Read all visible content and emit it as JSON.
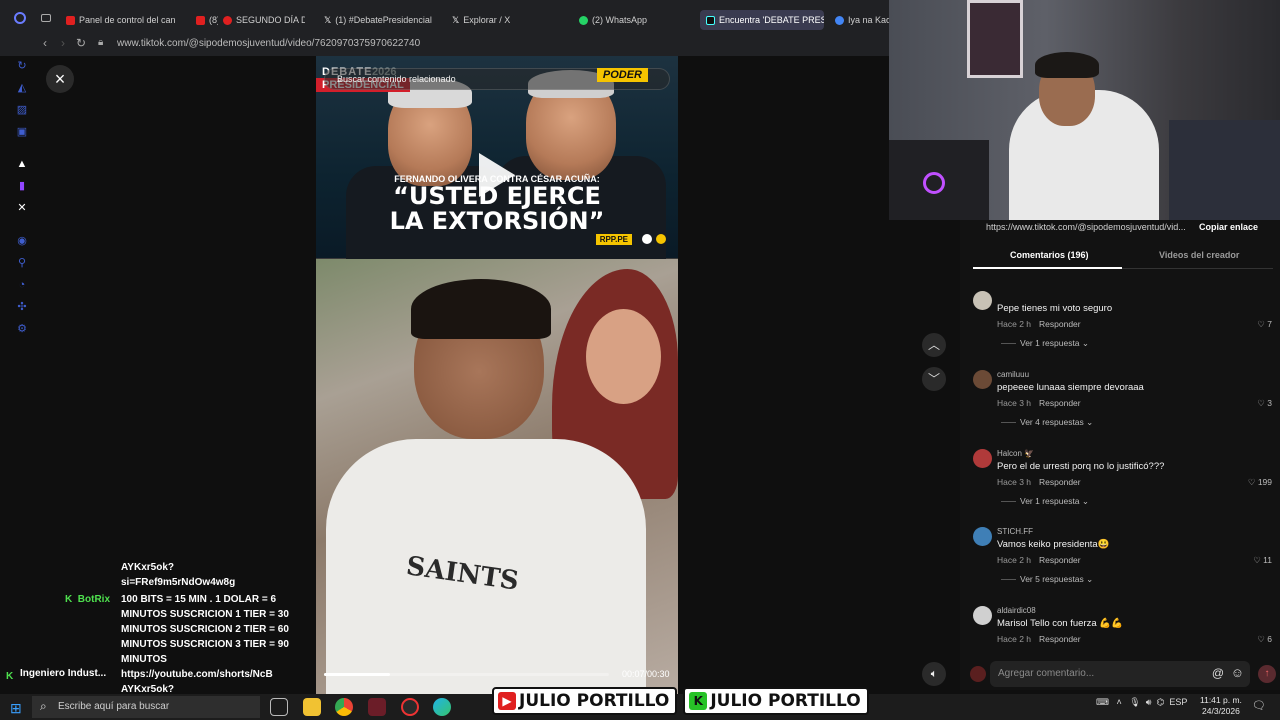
{
  "browser": {
    "tabs": [
      {
        "label": "Panel de control del canal",
        "color": "#e02020"
      },
      {
        "label": "(8)",
        "color": "#e02020"
      },
      {
        "label": "SEGUNDO DÍA DEL",
        "color": "#e02020"
      },
      {
        "label": "(1) #DebatePresidencial -",
        "color": "#ffffff"
      },
      {
        "label": "Explorar / X",
        "color": "#ffffff"
      },
      {
        "label": "(2) WhatsApp",
        "color": "#25d366"
      },
      {
        "label": "Encuentra 'DEBATE PRES",
        "color": "#111111"
      },
      {
        "label": "Iya na Kao",
        "color": "#4285f4"
      }
    ],
    "url": "www.tiktok.com/@sipodemosjuventud/video/7620970375970622740"
  },
  "video": {
    "search_placeholder": "Buscar contenido relacionado",
    "overlay_logo_top": "DEBATE",
    "overlay_logo_year": "2026",
    "overlay_logo_bottom": "PRESIDENCIAL",
    "overlay_brand": "PODER",
    "kicker": "FERNANDO OLIVERA CONTRA CÉSAR ACUÑA:",
    "quote_line1": "“USTED EJERCE",
    "quote_line2": "LA EXTORSIÓN”",
    "source": "RPP.PE",
    "shirt_text": "SAINTS",
    "time": "00:07/00:30",
    "progress": 0.23
  },
  "share": {
    "url": "https://www.tiktok.com/@sipodemosjuventud/vid...",
    "copy_label": "Copiar enlace"
  },
  "tabs": {
    "comments": "Comentarios (196)",
    "creator_videos": "Videos del creador"
  },
  "comments": [
    {
      "user": "",
      "text": "Pepe tienes mi voto seguro",
      "time": "Hace 2 h",
      "reply": "Responder",
      "likes": "7",
      "replies": "Ver 1 respuesta",
      "avatar_color": "#c8c2b6"
    },
    {
      "user": "camiluuu",
      "text": "pepeeee lunaaa siempre devoraaa",
      "time": "Hace 3 h",
      "reply": "Responder",
      "likes": "3",
      "replies": "Ver 4 respuestas",
      "avatar_color": "#6b4a36"
    },
    {
      "user": "Halcon 🦅",
      "text": "Pero el de urresti porq no lo justificó???",
      "time": "Hace 3 h",
      "reply": "Responder",
      "likes": "199",
      "replies": "Ver 1 respuesta",
      "avatar_color": "#b03a3a"
    },
    {
      "user": "STICH.FF",
      "text": "Vamos keiko presidenta😃",
      "time": "Hace 2 h",
      "reply": "Responder",
      "likes": "11",
      "replies": "Ver 5 respuestas",
      "avatar_color": "#3f7fb6"
    },
    {
      "user": "aldairdic08",
      "text": "Marisol Tello con fuerza 💪💪",
      "time": "Hace 2 h",
      "reply": "Responder",
      "likes": "6",
      "replies": "",
      "avatar_color": "#d0d0d0"
    }
  ],
  "comment_input": {
    "placeholder": "Agregar comentario..."
  },
  "chat": {
    "lines": [
      "AYKxr5ok?",
      "si=FRef9m5rNdOw4w8g"
    ],
    "bot_name": "BotRix",
    "bot_lines": [
      "100 BITS = 15 MIN . 1 DOLAR = 6",
      "MINUTOS SUSCRICION 1 TIER = 30",
      "MINUTOS SUSCRICION 2 TIER = 60",
      "MINUTOS SUSCRICION 3 TIER = 90",
      "MINUTOS",
      "https://youtube.com/shorts/NcB",
      "AYKxr5ok?"
    ],
    "user": "Ingeniero Indust..."
  },
  "taskbar": {
    "search_placeholder": "Escribe aquí para buscar",
    "lang": "ESP",
    "time": "11:41 p. m.",
    "date": "24/3/2026"
  },
  "banner": {
    "name1": "JULIO PORTILLO",
    "name2": "JULIO PORTILLO"
  }
}
